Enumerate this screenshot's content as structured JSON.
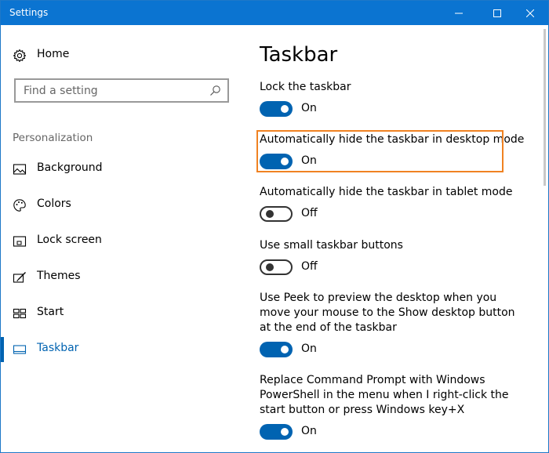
{
  "window": {
    "title": "Settings",
    "accent": "#0b74d1"
  },
  "sidebar": {
    "home_label": "Home",
    "search_placeholder": "Find a setting",
    "section_label": "Personalization",
    "items": [
      {
        "label": "Background",
        "icon": "image-icon"
      },
      {
        "label": "Colors",
        "icon": "palette-icon"
      },
      {
        "label": "Lock screen",
        "icon": "lock-screen-icon"
      },
      {
        "label": "Themes",
        "icon": "brush-icon"
      },
      {
        "label": "Start",
        "icon": "start-grid-icon"
      },
      {
        "label": "Taskbar",
        "icon": "taskbar-icon",
        "active": true
      }
    ]
  },
  "main": {
    "title": "Taskbar",
    "settings": [
      {
        "label": "Lock the taskbar",
        "state": "On",
        "on": true
      },
      {
        "label": "Automatically hide the taskbar in desktop mode",
        "state": "On",
        "on": true,
        "highlighted": true
      },
      {
        "label": "Automatically hide the taskbar in tablet mode",
        "state": "Off",
        "on": false
      },
      {
        "label": "Use small taskbar buttons",
        "state": "Off",
        "on": false
      },
      {
        "label": "Use Peek to preview the desktop when you move your mouse to the Show desktop button at the end of the taskbar",
        "state": "On",
        "on": true
      },
      {
        "label": "Replace Command Prompt with Windows PowerShell in the menu when I right-click the start button or press Windows key+X",
        "state": "On",
        "on": true
      }
    ]
  },
  "colors": {
    "toggle_on": "#0063b1",
    "highlight": "#f08222"
  }
}
